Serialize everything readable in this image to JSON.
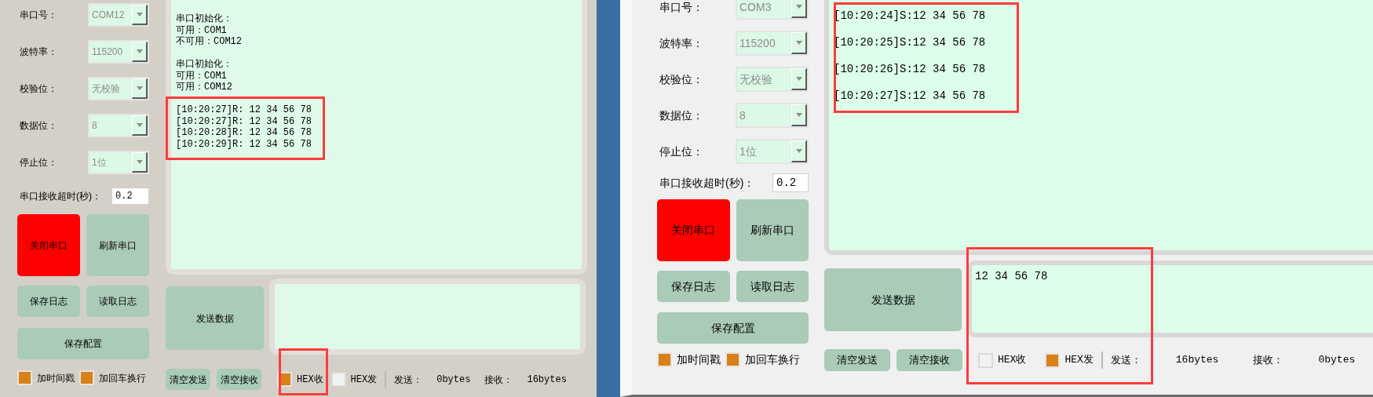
{
  "windows": [
    {
      "settings": [
        {
          "label": "串口号：",
          "value": "COM12"
        },
        {
          "label": "波特率：",
          "value": "115200"
        },
        {
          "label": "校验位：",
          "value": "无校验"
        },
        {
          "label": "数据位：",
          "value": "8"
        },
        {
          "label": "停止位：",
          "value": "1位"
        }
      ],
      "timeout": {
        "label": "串口接收超时(秒)：",
        "value": "0.2"
      },
      "port_buttons": [
        {
          "label": "关闭串口",
          "kind": "danger"
        },
        {
          "label": "刷新串口",
          "kind": "normal"
        }
      ],
      "log_buttons": [
        "保存日志",
        "读取日志"
      ],
      "config_button": "保存配置",
      "options": [
        {
          "label": "加时间戳",
          "checked": true
        },
        {
          "label": "加回车换行",
          "checked": true
        }
      ],
      "receive_blocks": [
        [
          "串口初始化：",
          "可用：COM1",
          "不可用：COM12"
        ],
        [
          "串口初始化：",
          "可用：COM1",
          "可用：COM12"
        ],
        [
          "[10:20:27]R: 12 34 56 78",
          "[10:20:27]R: 12 34 56 78",
          "[10:20:28]R: 12 34 56 78",
          "[10:20:29]R: 12 34 56 78"
        ]
      ],
      "send_button": "发送数据",
      "clear_buttons": [
        "清空发送",
        "清空接收"
      ],
      "hex_options": [
        {
          "label": "HEX收",
          "checked": true
        },
        {
          "label": "HEX发",
          "checked": false
        }
      ],
      "stats": [
        {
          "label": "发送：",
          "value": "0bytes"
        },
        {
          "label": "接收：",
          "value": "16bytes"
        }
      ]
    },
    {
      "settings": [
        {
          "label": "串口号：",
          "value": "COM3"
        },
        {
          "label": "波特率：",
          "value": "115200"
        },
        {
          "label": "校验位：",
          "value": "无校验"
        },
        {
          "label": "数据位：",
          "value": "8"
        },
        {
          "label": "停止位：",
          "value": "1位"
        }
      ],
      "timeout": {
        "label": "串口接收超时(秒)：",
        "value": "0.2"
      },
      "port_buttons": [
        {
          "label": "关闭串口",
          "kind": "danger"
        },
        {
          "label": "刷新串口",
          "kind": "normal"
        }
      ],
      "log_buttons": [
        "保存日志",
        "读取日志"
      ],
      "config_button": "保存配置",
      "options": [
        {
          "label": "加时间戳",
          "checked": true
        },
        {
          "label": "加回车换行",
          "checked": true
        }
      ],
      "receive_blocks": [
        [
          "[10:20:24]S:12 34 56 78"
        ],
        [
          "[10:20:25]S:12 34 56 78"
        ],
        [
          "[10:20:26]S:12 34 56 78"
        ],
        [
          "[10:20:27]S:12 34 56 78"
        ]
      ],
      "send_button": "发送数据",
      "send_text": "12 34 56 78",
      "clear_buttons": [
        "清空发送",
        "清空接收"
      ],
      "hex_options": [
        {
          "label": "HEX收",
          "checked": false
        },
        {
          "label": "HEX发",
          "checked": true
        }
      ],
      "stats": [
        {
          "label": "发送：",
          "value": "16bytes"
        },
        {
          "label": "接收：",
          "value": "0bytes"
        }
      ]
    }
  ]
}
